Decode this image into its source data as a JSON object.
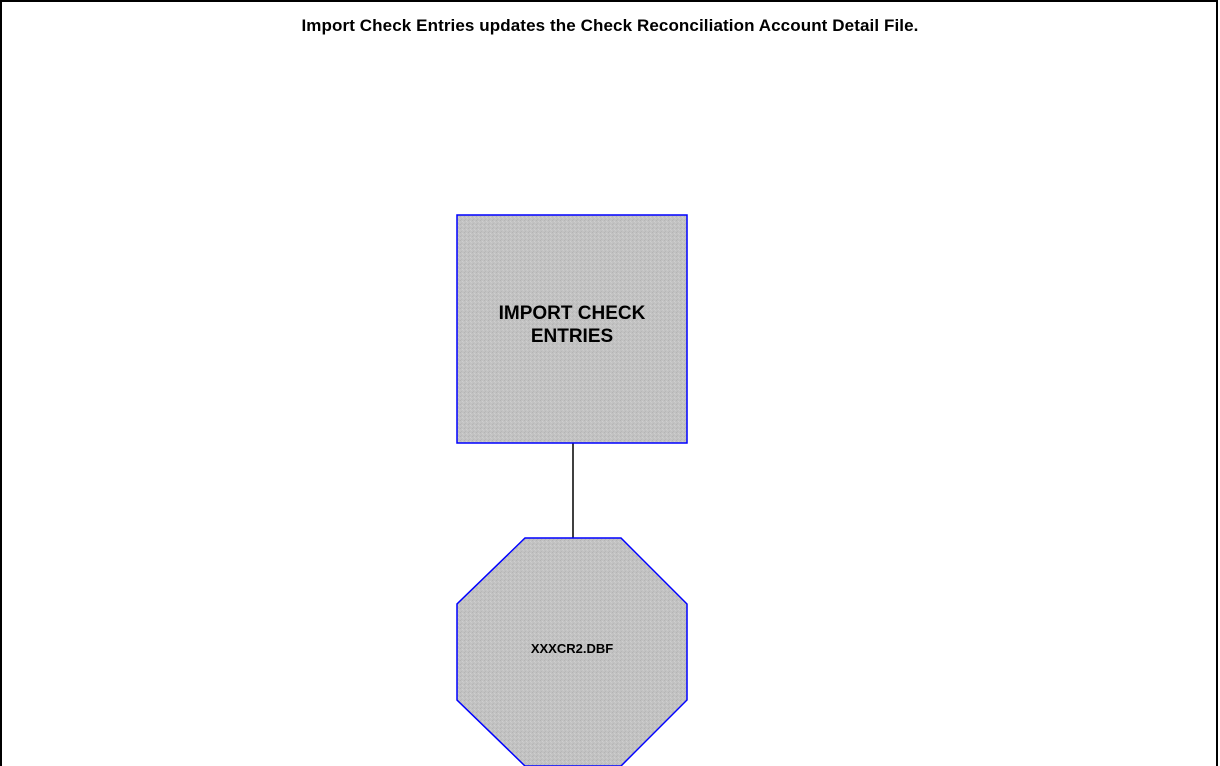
{
  "title": "Import Check Entries updates the Check Reconciliation Account Detail File.",
  "process_box": {
    "line1": "IMPORT CHECK",
    "line2": "ENTRIES"
  },
  "data_store": {
    "label": "XXXCR2.DBF"
  },
  "colors": {
    "shape_fill": "#c0c0c0",
    "shape_border": "#0000ff",
    "connector": "#000000",
    "frame": "#000000"
  }
}
